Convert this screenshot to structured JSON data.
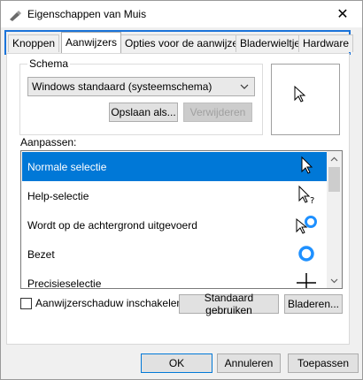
{
  "window": {
    "title": "Eigenschappen van Muis",
    "close_glyph": "✕"
  },
  "tabs": [
    {
      "label": "Knoppen",
      "active": false
    },
    {
      "label": "Aanwijzers",
      "active": true
    },
    {
      "label": "Opties voor de aanwijzer",
      "active": false
    },
    {
      "label": "Bladerwieltje",
      "active": false
    },
    {
      "label": "Hardware",
      "active": false
    }
  ],
  "schema": {
    "group_label": "Schema",
    "selected": "Windows standaard (systeemschema)",
    "save_label": "Opslaan als...",
    "delete_label": "Verwijderen"
  },
  "preview": {
    "icon": "arrow-pointer-icon"
  },
  "customize": {
    "label": "Aanpassen:",
    "items": [
      {
        "label": "Normale selectie",
        "icon": "arrow-pointer-icon",
        "selected": true
      },
      {
        "label": "Help-selectie",
        "icon": "help-pointer-icon",
        "selected": false
      },
      {
        "label": "Wordt op de achtergrond uitgevoerd",
        "icon": "working-in-background-icon",
        "selected": false
      },
      {
        "label": "Bezet",
        "icon": "busy-icon",
        "selected": false
      },
      {
        "label": "Precisieselectie",
        "icon": "crosshair-icon",
        "selected": false
      }
    ]
  },
  "options": {
    "shadow_label": "Aanwijzerschaduw inschakelen",
    "shadow_checked": false,
    "default_label": "Standaard gebruiken",
    "browse_label": "Bladeren..."
  },
  "footer": {
    "ok_label": "OK",
    "cancel_label": "Annuleren",
    "apply_label": "Toepassen"
  },
  "colors": {
    "selection": "#0078d7",
    "tab_focus": "#1a73d9",
    "busy_ring": "#1e90ff"
  }
}
